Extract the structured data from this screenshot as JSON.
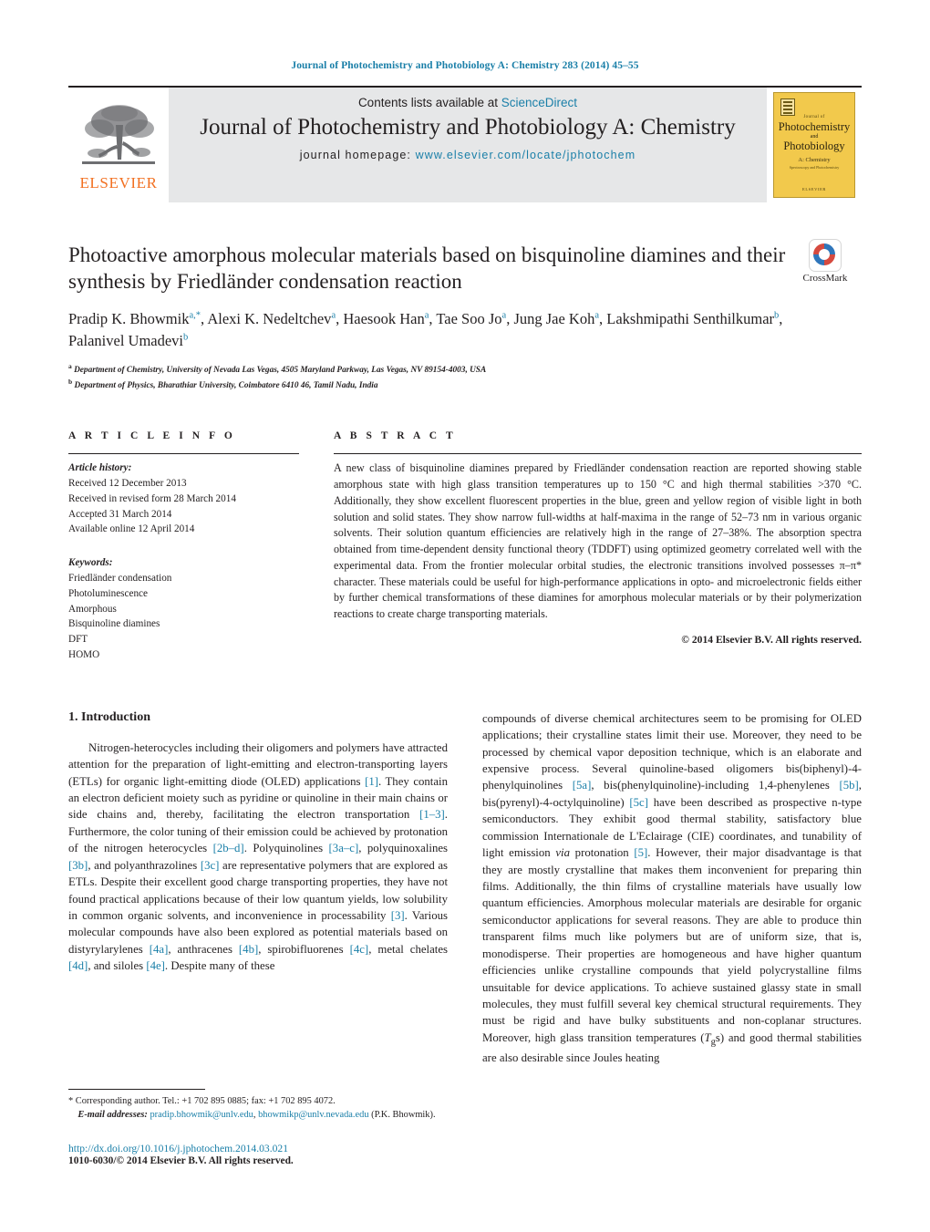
{
  "running_head": "Journal of Photochemistry and Photobiology A: Chemistry 283 (2014) 45–55",
  "masthead": {
    "publisher_name": "ELSEVIER",
    "contents_prefix": "Contents lists available at ",
    "contents_link": "ScienceDirect",
    "journal_title": "Journal of Photochemistry and Photobiology A: Chemistry",
    "homepage_label": "journal homepage:",
    "homepage_url": "www.elsevier.com/locate/jphotochem",
    "cover": {
      "small_top": "Journal of",
      "line1": "Photochemistry",
      "line2": "and",
      "line3": "Photobiology",
      "sub": "A: Chemistry",
      "sub2": "Spectroscopy and Photochemistry",
      "footer": "ELSEVIER"
    }
  },
  "article": {
    "title": "Photoactive amorphous molecular materials based on bisquinoline diamines and their synthesis by Friedländer condensation reaction",
    "authors_line1": "Pradip K. Bhowmik",
    "authors": [
      {
        "name": "Pradip K. Bhowmik",
        "sup": "a,*"
      },
      {
        "name": "Alexi K. Nedeltchev",
        "sup": "a"
      },
      {
        "name": "Haesook Han",
        "sup": "a"
      },
      {
        "name": "Tae Soo Jo",
        "sup": "a"
      },
      {
        "name": "Jung Jae Koh",
        "sup": "a"
      },
      {
        "name": "Lakshmipathi Senthilkumar",
        "sup": "b"
      },
      {
        "name": "Palanivel Umadevi",
        "sup": "b"
      }
    ],
    "affiliations": [
      {
        "mark": "a",
        "text": "Department of Chemistry, University of Nevada Las Vegas, 4505 Maryland Parkway, Las Vegas, NV 89154-4003, USA"
      },
      {
        "mark": "b",
        "text": "Department of Physics, Bharathiar University, Coimbatore 6410 46, Tamil Nadu, India"
      }
    ],
    "crossmark_label": "CrossMark"
  },
  "article_info": {
    "heading": "A R T I C L E   I N F O",
    "history_label": "Article history:",
    "history": [
      "Received 12 December 2013",
      "Received in revised form 28 March 2014",
      "Accepted 31 March 2014",
      "Available online 12 April 2014"
    ],
    "keywords_label": "Keywords:",
    "keywords": [
      "Friedländer condensation",
      "Photoluminescence",
      "Amorphous",
      "Bisquinoline diamines",
      "DFT",
      "HOMO"
    ]
  },
  "abstract": {
    "heading": "A B S T R A C T",
    "text": "A new class of bisquinoline diamines prepared by Friedländer condensation reaction are reported showing stable amorphous state with high glass transition temperatures up to 150 °C and high thermal stabilities >370 °C. Additionally, they show excellent fluorescent properties in the blue, green and yellow region of visible light in both solution and solid states. They show narrow full-widths at half-maxima in the range of 52–73 nm in various organic solvents. Their solution quantum efficiencies are relatively high in the range of 27–38%. The absorption spectra obtained from time-dependent density functional theory (TDDFT) using optimized geometry correlated well with the experimental data. From the frontier molecular orbital studies, the electronic transitions involved possesses π–π* character. These materials could be useful for high-performance applications in opto- and microelectronic fields either by further chemical transformations of these diamines for amorphous molecular materials or by their polymerization reactions to create charge transporting materials.",
    "copyright": "© 2014 Elsevier B.V. All rights reserved."
  },
  "body": {
    "section_number_title": "1.  Introduction",
    "left_paragraph_html": "Nitrogen-heterocycles including their oligomers and polymers have attracted attention for the preparation of light-emitting and electron-transporting layers (ETLs) for organic light-emitting diode (OLED) applications <a class=\"ref\">[1]</a>. They contain an electron deficient moiety such as pyridine or quinoline in their main chains or side chains and, thereby, facilitating the electron transportation <a class=\"ref\">[1–3]</a>. Furthermore, the color tuning of their emission could be achieved by protonation of the nitrogen heterocycles <a class=\"ref\">[2b–d]</a>. Polyquinolines <a class=\"ref\">[3a–c]</a>, polyquinoxalines <a class=\"ref\">[3b]</a>, and polyanthrazolines <a class=\"ref\">[3c]</a> are representative polymers that are explored as ETLs. Despite their excellent good charge transporting properties, they have not found practical applications because of their low quantum yields, low solubility in common organic solvents, and inconvenience in processability <a class=\"ref\">[3]</a>. Various molecular compounds have also been explored as potential materials based on distyrylarylenes <a class=\"ref\">[4a]</a>, anthracenes <a class=\"ref\">[4b]</a>, spirobifluorenes <a class=\"ref\">[4c]</a>, metal chelates <a class=\"ref\">[4d]</a>, and siloles <a class=\"ref\">[4e]</a>. Despite many of these",
    "right_paragraph_html": "compounds of diverse chemical architectures seem to be promising for OLED applications; their crystalline states limit their use. Moreover, they need to be processed by chemical vapor deposition technique, which is an elaborate and expensive process. Several quinoline-based oligomers bis(biphenyl)-4-phenylquinolines <a class=\"ref\">[5a]</a>, bis(phenylquinoline)-including 1,4-phenylenes <a class=\"ref\">[5b]</a>, bis(pyrenyl)-4-octylquinoline) <a class=\"ref\">[5c]</a> have been described as prospective n-type semiconductors. They exhibit good thermal stability, satisfactory blue commission Internationale de L'Eclairage (CIE) coordinates, and tunability of light emission <i>via</i> protonation <a class=\"ref\">[5]</a>. However, their major disadvantage is that they are mostly crystalline that makes them inconvenient for preparing thin films. Additionally, the thin films of crystalline materials have usually low quantum efficiencies. Amorphous molecular materials are desirable for organic semiconductor applications for several reasons. They are able to produce thin transparent films much like polymers but are of uniform size, that is, monodisperse. Their properties are homogeneous and have higher quantum efficiencies unlike crystalline compounds that yield polycrystalline films unsuitable for device applications. To achieve sustained glassy state in small molecules, they must fulfill several key chemical structural requirements. They must be rigid and have bulky substituents and non-coplanar structures. Moreover, high glass transition temperatures (<i>T</i><sub>g</sub>s) and good thermal stabilities are also desirable since Joules heating"
  },
  "footnotes": {
    "corresponding": "* Corresponding author. Tel.: +1 702 895 0885; fax: +1 702 895 4072.",
    "email_label": "E-mail addresses:",
    "emails": [
      "pradip.bhowmik@unlv.edu",
      "bhowmikp@unlv.nevada.edu"
    ],
    "email_owner": "(P.K. Bhowmik).",
    "doi": "http://dx.doi.org/10.1016/j.jphotochem.2014.03.021",
    "issn_line": "1010-6030/© 2014 Elsevier B.V. All rights reserved."
  },
  "colors": {
    "link": "#1a7fa8",
    "elsevier_orange": "#f27021",
    "masthead_grey": "#e6e7e8",
    "cover_yellow": "#f2c94c"
  }
}
